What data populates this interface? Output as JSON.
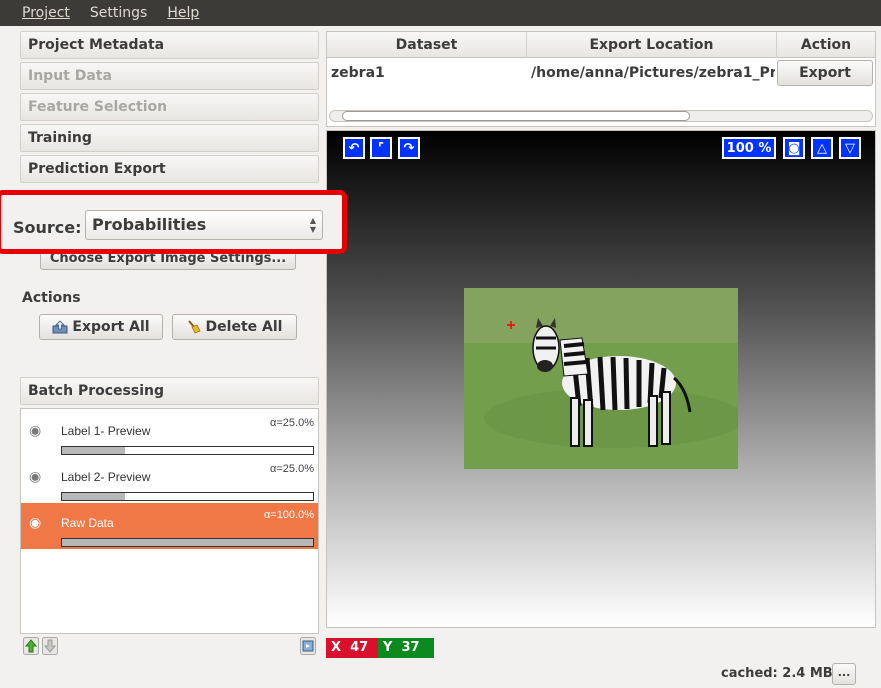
{
  "menu": {
    "project": "Project",
    "settings": "Settings",
    "help": "Help"
  },
  "applets": {
    "project_metadata": "Project Metadata",
    "input_data": "Input Data",
    "feature_selection": "Feature Selection",
    "training": "Training",
    "prediction_export": "Prediction Export",
    "batch_processing": "Batch Processing"
  },
  "export_settings": {
    "source_label": "Source:",
    "source_value": "Probabilities",
    "choose_button": "Choose Export Image Settings..."
  },
  "actions": {
    "title": "Actions",
    "export_all": "Export All",
    "delete_all": "Delete All"
  },
  "layers": [
    {
      "name": "Label 1- Preview",
      "alpha": "α=25.0%",
      "opacity": 0.25
    },
    {
      "name": "Label 2- Preview",
      "alpha": "α=25.0%",
      "opacity": 0.25
    },
    {
      "name": "Raw Data",
      "alpha": "α=100.0%",
      "opacity": 1.0
    }
  ],
  "table": {
    "headers": [
      "Dataset",
      "Export Location",
      "Action"
    ],
    "rows": [
      {
        "dataset": "zebra1",
        "location": "/home/anna/Pictures/zebra1_Pr...",
        "action": "Export"
      }
    ]
  },
  "viewer": {
    "zoom": "100 %"
  },
  "coords": {
    "x_label": "X",
    "x_value": "47",
    "y_label": "Y",
    "y_value": "37"
  },
  "status": {
    "cache": "cached: 2.4 MB",
    "more_button": "..."
  },
  "colors": {
    "selected_layer": "#f07746",
    "viewer_button": "#0033ff",
    "x_coord": "#d8102c",
    "y_coord": "#0c8a1e"
  }
}
